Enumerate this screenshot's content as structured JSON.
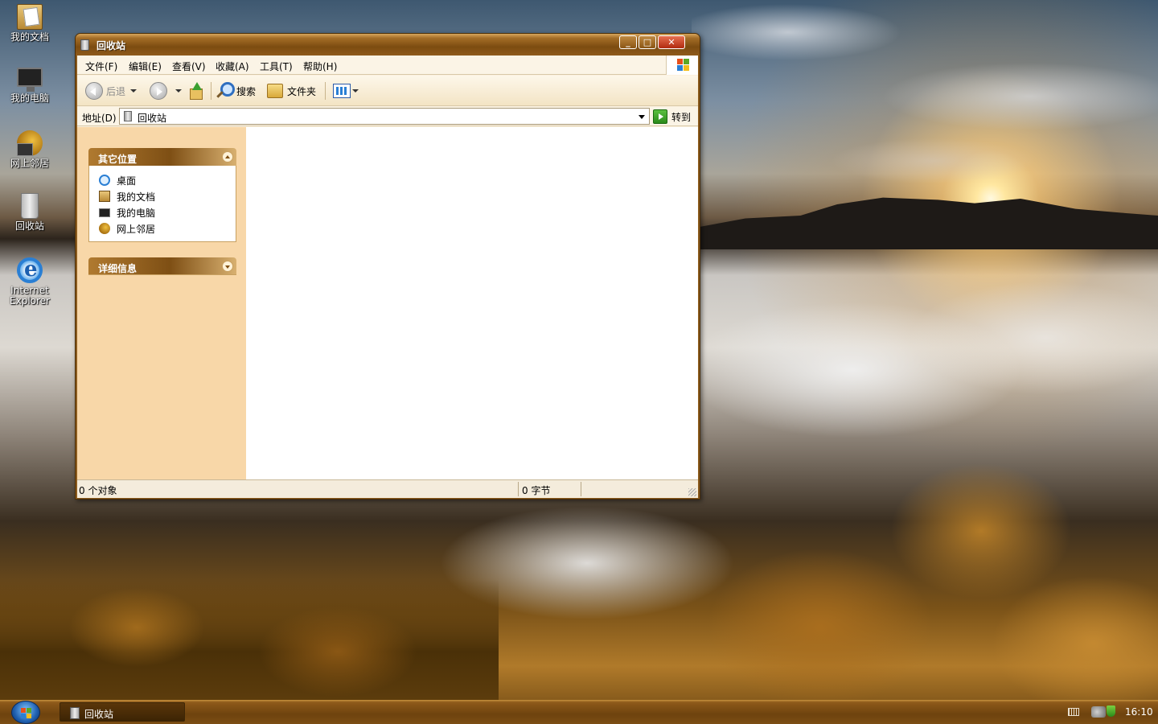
{
  "desktop": {
    "icons": [
      {
        "label": "我的文档"
      },
      {
        "label": "我的电脑"
      },
      {
        "label": "网上邻居"
      },
      {
        "label": "回收站"
      },
      {
        "label": "Internet Explorer"
      }
    ]
  },
  "window": {
    "title": "回收站",
    "menu": [
      "文件(F)",
      "编辑(E)",
      "查看(V)",
      "收藏(A)",
      "工具(T)",
      "帮助(H)"
    ],
    "toolbar": {
      "back_label": "后退",
      "search_label": "搜索",
      "folders_label": "文件夹"
    },
    "address": {
      "label": "地址(D)",
      "value": "回收站",
      "go_label": "转到"
    },
    "left_pane": {
      "other_places": {
        "title": "其它位置",
        "items": [
          "桌面",
          "我的文档",
          "我的电脑",
          "网上邻居"
        ]
      },
      "details": {
        "title": "详细信息"
      }
    },
    "status": {
      "objects": "0 个对象",
      "size": "0 字节"
    }
  },
  "taskbar": {
    "task_title": "回收站",
    "clock": "16:10"
  }
}
